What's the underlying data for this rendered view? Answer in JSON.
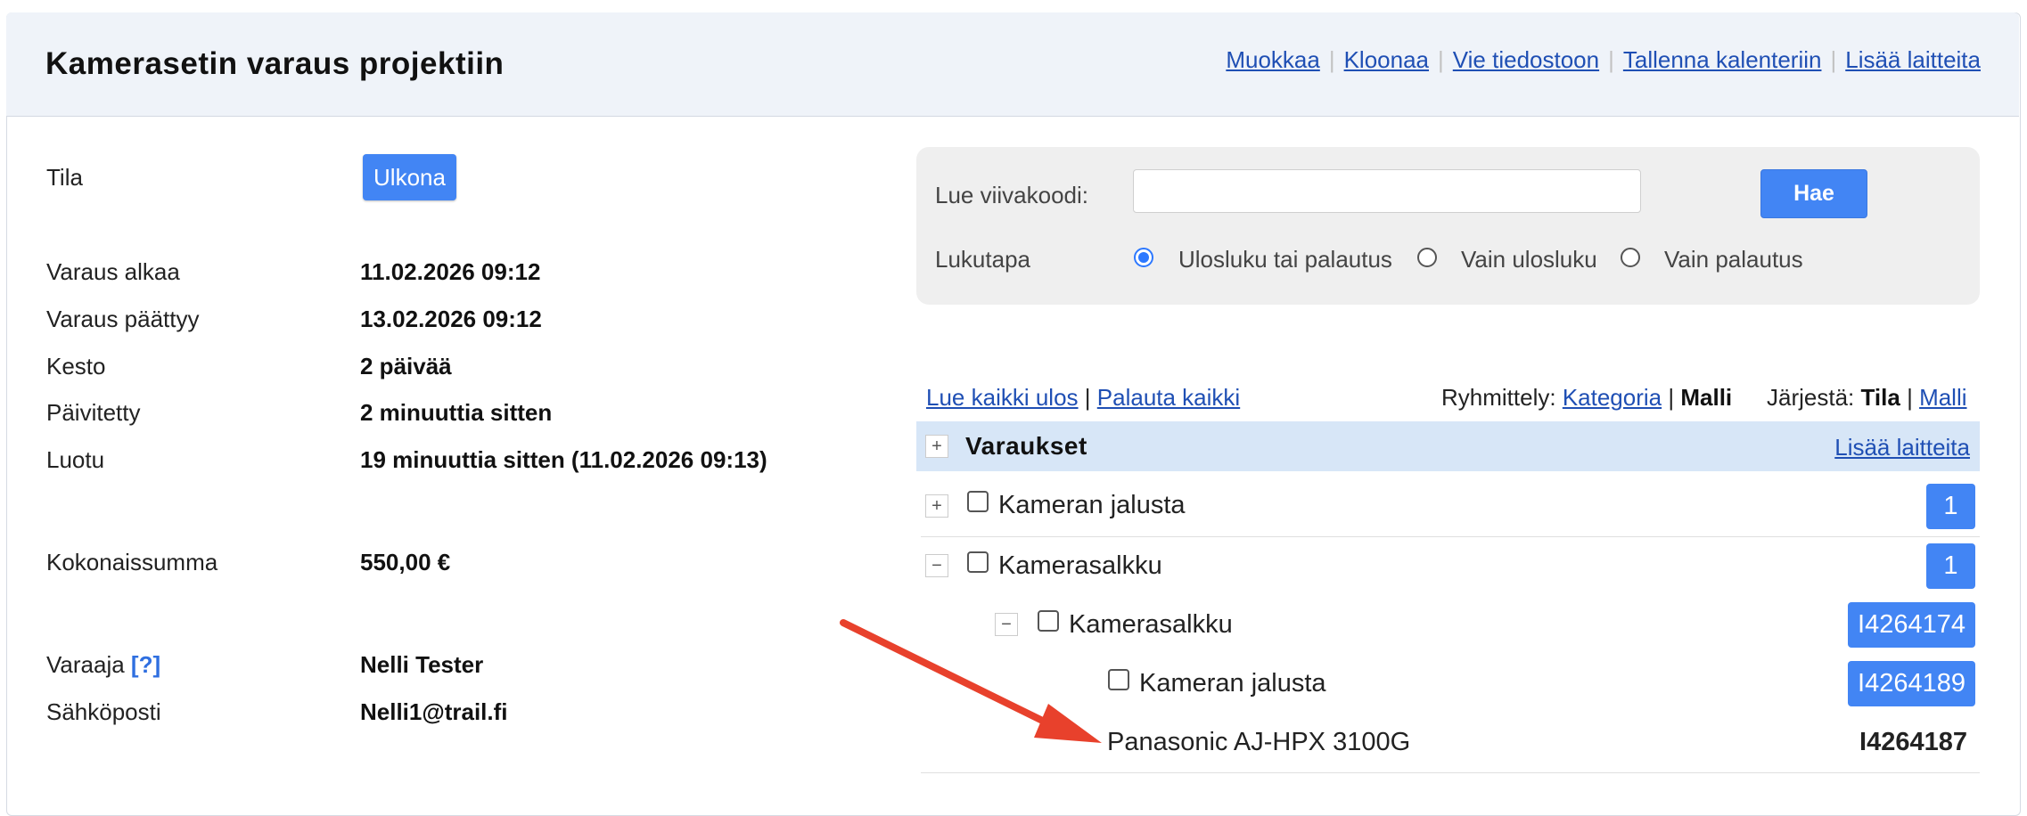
{
  "header": {
    "title": "Kamerasetin varaus projektiin",
    "links": [
      "Muokkaa",
      "Kloonaa",
      "Vie tiedostoon",
      "Tallenna kalenteriin",
      "Lisää laitteita"
    ],
    "separator": "|"
  },
  "details": {
    "status_label": "Tila",
    "status_value": "Ulkona",
    "rows": [
      {
        "label": "Varaus alkaa",
        "value": "11.02.2026 09:12"
      },
      {
        "label": "Varaus päättyy",
        "value": "13.02.2026 09:12"
      },
      {
        "label": "Kesto",
        "value": "2 päivää"
      },
      {
        "label": "Päivitetty",
        "value": "2 minuuttia sitten"
      },
      {
        "label": "Luotu",
        "value": "19 minuuttia sitten (11.02.2026 09:13)"
      }
    ],
    "total_label": "Kokonaissumma",
    "total_value": "550,00 €",
    "booker_label": "Varaaja",
    "booker_help": "[?]",
    "booker_value": "Nelli Tester",
    "email_label": "Sähköposti",
    "email_value": "Nelli1@trail.fi"
  },
  "scan": {
    "barcode_label": "Lue viivakoodi:",
    "barcode_value": "",
    "search_button": "Hae",
    "mode_label": "Lukutapa",
    "modes": [
      "Ulosluku tai palautus",
      "Vain ulosluku",
      "Vain palautus"
    ],
    "selected_mode": "Ulosluku tai palautus"
  },
  "actions": {
    "check_out_all": "Lue kaikki ulos",
    "return_all": "Palauta kaikki",
    "separator": "|",
    "grouping_label": "Ryhmittely:",
    "grouping_category": "Kategoria",
    "grouping_model": "Malli",
    "sort_label": "Järjestä:",
    "sort_status": "Tila",
    "sort_model": "Malli"
  },
  "reservations": {
    "title": "Varaukset",
    "add_link": "Lisää laitteita",
    "toggle_plus": "+",
    "toggle_minus": "−",
    "rows": [
      {
        "label": "Kameran jalusta",
        "badge": "1"
      },
      {
        "label": "Kamerasalkku",
        "badge": "1"
      },
      {
        "label": "Kamerasalkku",
        "badge": "I4264174"
      },
      {
        "label": "Kameran jalusta",
        "badge": "I4264189"
      },
      {
        "label": "Panasonic AJ-HPX 3100G",
        "badge": "I4264187"
      }
    ]
  },
  "colors": {
    "accent": "#4285f4",
    "link": "#1f4fb4",
    "header_bg": "#eff3f9",
    "table_head_bg": "#d7e6f7",
    "arrow": "#e8412c"
  }
}
